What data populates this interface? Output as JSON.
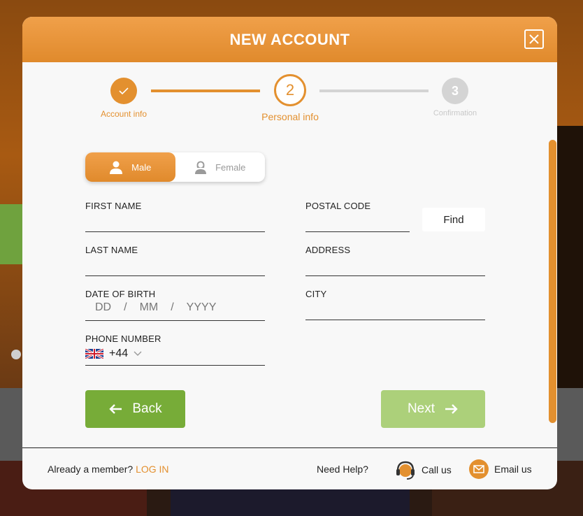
{
  "modal": {
    "title": "NEW ACCOUNT"
  },
  "stepper": {
    "steps": [
      {
        "label": "Account info",
        "number": ""
      },
      {
        "label": "Personal info",
        "number": "2"
      },
      {
        "label": "Confirmation",
        "number": "3"
      }
    ]
  },
  "gender": {
    "male_label": "Male",
    "female_label": "Female"
  },
  "fields": {
    "first_name": "FIRST NAME",
    "last_name": "LAST NAME",
    "date_of_birth": "DATE OF BIRTH",
    "dob_day": "DD",
    "dob_month": "MM",
    "dob_year": "YYYY",
    "dob_separator": "/",
    "phone_number": "PHONE NUMBER",
    "phone_prefix": "+44",
    "postal_code": "POSTAL CODE",
    "address": "ADDRESS",
    "city": "CITY"
  },
  "buttons": {
    "find": "Find",
    "back": "Back",
    "next": "Next"
  },
  "footer": {
    "already_member": "Already a member?",
    "log_in": "LOG IN",
    "need_help": "Need Help?",
    "call_us": "Call us",
    "email_us": "Email us"
  },
  "colors": {
    "accent": "#e3902f",
    "back_button": "#77ac38",
    "next_button": "#acd07a",
    "inactive": "#d4d4d4"
  }
}
